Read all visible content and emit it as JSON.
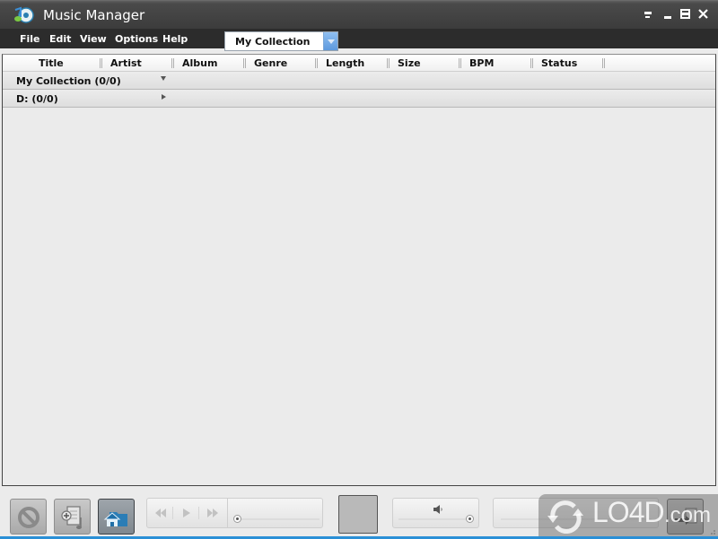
{
  "window": {
    "title": "Music Manager",
    "app_icon": "music-disc-icon",
    "controls": {
      "compact_icon": "compact-mode-icon",
      "minimize_icon": "minimize-icon",
      "maximize_icon": "maximize-icon",
      "close_icon": "close-icon"
    }
  },
  "menu": {
    "items": [
      {
        "label": "File"
      },
      {
        "label": "Edit"
      },
      {
        "label": "View"
      },
      {
        "label": "Options"
      },
      {
        "label": "Help"
      }
    ]
  },
  "collection_select": {
    "selected": "My Collection",
    "arrow_color": "#5d99de"
  },
  "table": {
    "columns": [
      {
        "label": "Title"
      },
      {
        "label": "Artist"
      },
      {
        "label": "Album"
      },
      {
        "label": "Genre"
      },
      {
        "label": "Length"
      },
      {
        "label": "Size"
      },
      {
        "label": "BPM"
      },
      {
        "label": "Status"
      }
    ],
    "groups": [
      {
        "label": "My Collection (0/0)",
        "state": "expanded"
      },
      {
        "label": "D: (0/0)",
        "state": "collapsed"
      }
    ],
    "rows": []
  },
  "toolbar": {
    "buttons": [
      {
        "name": "cancel",
        "icon": "prohibit-icon"
      },
      {
        "name": "add-to-playlist",
        "icon": "add-document-icon"
      },
      {
        "name": "home-folder",
        "icon": "home-folder-icon",
        "active": true
      }
    ],
    "transport": {
      "rewind_icon": "rewind-icon",
      "play_icon": "play-icon",
      "fast_forward_icon": "fast-forward-icon",
      "seek_position": 0
    },
    "volume": {
      "icon": "speaker-icon",
      "level": 1.0
    },
    "export_icon": "export-icon"
  },
  "watermark": {
    "text": "LO4D",
    "suffix": ".com"
  },
  "colors": {
    "titlebar": "#3c3c3c",
    "menubar": "#2c2c2c",
    "accent_line": "#2a8fd6",
    "background": "#ebebeb"
  }
}
